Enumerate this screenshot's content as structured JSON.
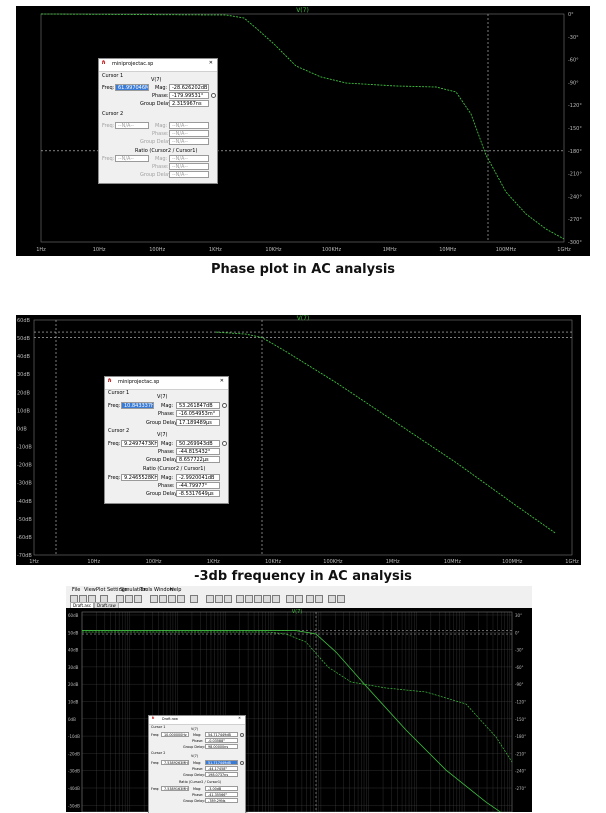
{
  "captions": {
    "phase": "Phase plot in AC analysis",
    "db3": "-3db frequency in AC analysis"
  },
  "plot1": {
    "trace_label": "V(7)",
    "x_ticks": [
      "1Hz",
      "10Hz",
      "100Hz",
      "1KHz",
      "10KHz",
      "100KHz",
      "1MHz",
      "10MHz",
      "100MHz",
      "1GHz"
    ],
    "y_ticks": [
      "0°",
      "-30°",
      "-60°",
      "-90°",
      "-120°",
      "-150°",
      "-180°",
      "-210°",
      "-240°",
      "-270°",
      "-300°"
    ],
    "trace_color": "#3fbf3f",
    "dialog": {
      "title": "miniprojectac.sp",
      "cursor1_label": "Cursor 1",
      "trace": "V(7)",
      "freq_label": "Freq:",
      "freq_value": "61.997046MHz",
      "mag_label": "Mag:",
      "mag_value": "-28.626202dB",
      "phase_label": "Phase:",
      "phase_value": "-179.99531°",
      "gd_label": "Group Delay:",
      "gd_value": "2.315967ns",
      "cursor2_label": "Cursor 2",
      "na": "--N/A--",
      "ratio_label": "Ratio (Cursor2 / Cursor1)"
    }
  },
  "plot2": {
    "trace_label": "V(7)",
    "x_ticks": [
      "1Hz",
      "10Hz",
      "100Hz",
      "1KHz",
      "10KHz",
      "100KHz",
      "1MHz",
      "10MHz",
      "100MHz",
      "1GHz"
    ],
    "y_ticks": [
      "60dB",
      "50dB",
      "40dB",
      "30dB",
      "20dB",
      "10dB",
      "0dB",
      "-10dB",
      "-20dB",
      "-30dB",
      "-40dB",
      "-50dB",
      "-60dB",
      "-70dB"
    ],
    "trace_color": "#3fbf3f",
    "dialog": {
      "title": "miniprojectac.sp",
      "cursor1_label": "Cursor 1",
      "trace1": "V(7)",
      "freq_label": "Freq:",
      "freq1_value": "10.843337Hz",
      "mag_label": "Mag:",
      "mag1_value": "53.261847dB",
      "phase_label": "Phase:",
      "phase1_value": "-16.054953m°",
      "gd_label": "Group Delay:",
      "gd1_value": "17.189489µs",
      "cursor2_label": "Cursor 2",
      "trace2": "V(7)",
      "freq2_value": "9.2497473KHz",
      "mag2_value": "50.269943dB",
      "phase2_value": "-44.815432°",
      "gd2_value": "8.657722µs",
      "ratio_label": "Ratio (Cursor2 / Cursor1)",
      "freq3_value": "9.2465528KHz",
      "mag3_value": "-2.9920041dB",
      "phase3_value": "-44.79977°",
      "gd3_value": "-8.5317649µs"
    }
  },
  "plot3": {
    "menu": [
      "File",
      "View",
      "Plot Settings",
      "Simulation",
      "Tools",
      "Window",
      "Help"
    ],
    "tabs": [
      "Draft.asc",
      "Draft.raw"
    ],
    "trace_label": "V(7)",
    "y_left": [
      "60dB",
      "50dB",
      "40dB",
      "30dB",
      "20dB",
      "10dB",
      "0dB",
      "-10dB",
      "-20dB",
      "-30dB",
      "-40dB",
      "-50dB",
      "-60dB"
    ],
    "y_right": [
      "30°",
      "0°",
      "-30°",
      "-60°",
      "-90°",
      "-120°",
      "-150°",
      "-180°",
      "-210°",
      "-240°",
      "-270°"
    ],
    "dialog": {
      "title": "Draft.raw",
      "cursor1_label": "Cursor 1",
      "trace1": "V(7)",
      "freq1_value": "10.000000Hz",
      "mag1_value": "54.717449dB",
      "phase1_value": "-0.03588°",
      "gd1_value": "98.00000ns",
      "cursor2_label": "Cursor 2",
      "trace2": "V(7)",
      "freq2_value": "7.5389263MHz",
      "mag2_value": "51.717449dB",
      "phase2_value": "-44.17458°",
      "gd2_value": "198.0737ns",
      "ratio_label": "Ratio (Cursor2 / Cursor1)",
      "freq3_value": "7.5389163MHz",
      "mag3_value": "-3.00dB",
      "phase3_value": "-41.35566°",
      "gd3_value": "-789.29Ns",
      "freq_label": "Freq:",
      "mag_label": "Mag:",
      "phase_label": "Phase:",
      "gd_label": "Group Delay:"
    }
  }
}
